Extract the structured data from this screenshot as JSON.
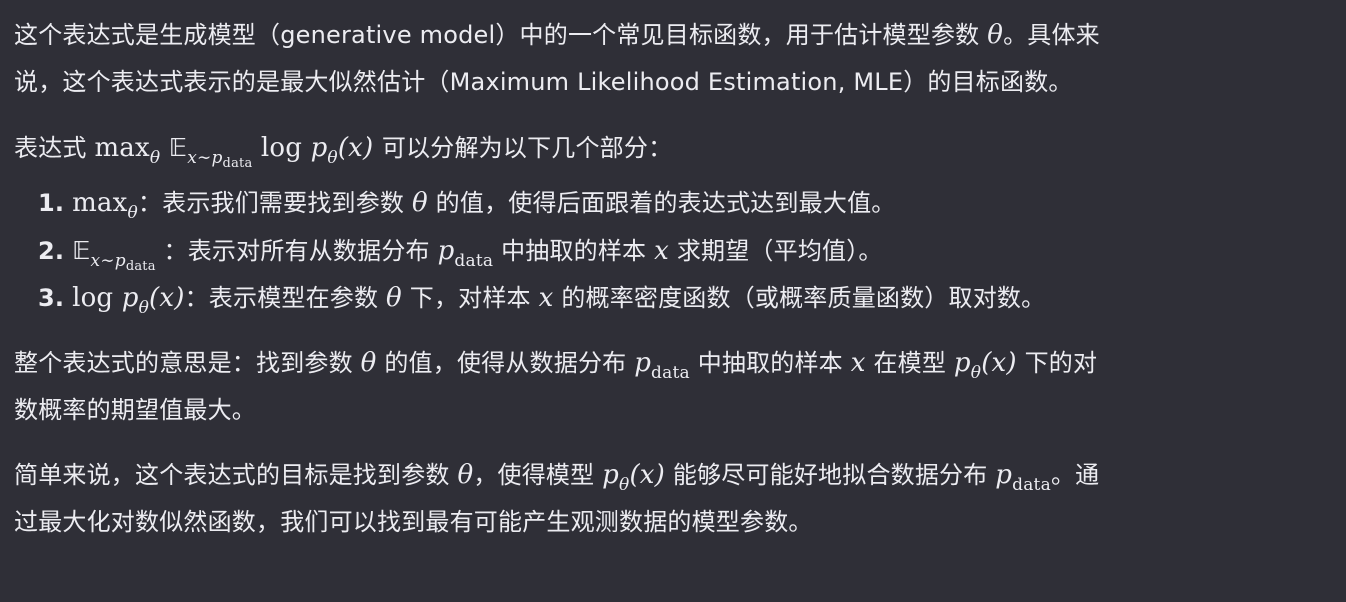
{
  "para1": {
    "line1": "这个表达式是生成模型（generative model）中的一个常见目标函数，用于估计模型参数",
    "theta": "θ",
    "line1_end": "。具体来",
    "line2": "说，这个表达式表示的是最大似然估计（Maximum Likelihood Estimation, MLE）的目标函数。"
  },
  "para2": {
    "prefix": "表达式",
    "max": "max",
    "theta": "θ",
    "E": "𝔼",
    "x_tilde": "x∼p",
    "data": "data",
    "log": "log",
    "p": "p",
    "x_arg": "(x)",
    "suffix": "可以分解为以下几个部分："
  },
  "list": {
    "item1_num": "1.",
    "item1_desc": "：表示我们需要找到参数",
    "item1_theta": "θ",
    "item1_end": "的值，使得后面跟着的表达式达到最大值。",
    "item2_num": "2.",
    "item2_desc": "：表示对所有从数据分布",
    "item2_end": "中抽取的样本",
    "item2_x": "x",
    "item2_tail": "求期望（平均值）。",
    "item3_num": "3.",
    "item3_desc": "：表示模型在参数",
    "item3_mid": "下，对样本",
    "item3_x": "x",
    "item3_tail": "的概率密度函数（或概率质量函数）取对数。"
  },
  "para3": {
    "a": "整个表达式的意思是：找到参数",
    "b": "的值，使得从数据分布",
    "c": "中抽取的样本",
    "d": "在模型",
    "e": "下的对",
    "line2": "数概率的期望值最大。"
  },
  "para4": {
    "a": "简单来说，这个表达式的目标是找到参数",
    "b": "，使得模型",
    "c": "能够尽可能好地拟合数据分布",
    "d": "。通",
    "line2": "过最大化对数似然函数，我们可以找到最有可能产生观测数据的模型参数。"
  }
}
